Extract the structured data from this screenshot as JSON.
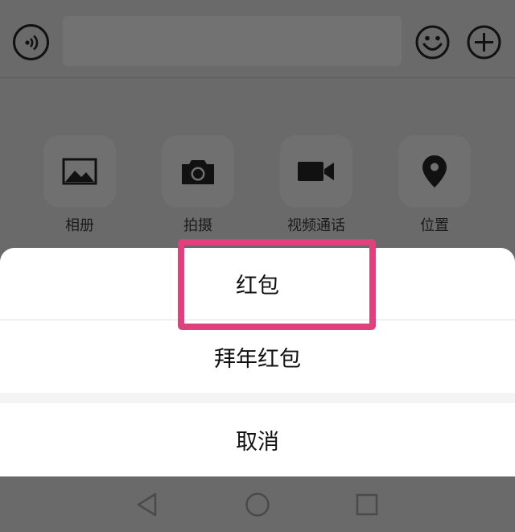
{
  "input_bar": {
    "voice_icon": "voice-icon",
    "emoji_icon": "emoji-icon",
    "plus_icon": "plus-icon"
  },
  "panel": {
    "items": [
      {
        "label": "相册",
        "icon": "image-icon"
      },
      {
        "label": "拍摄",
        "icon": "camera-icon"
      },
      {
        "label": "视频通话",
        "icon": "video-icon"
      },
      {
        "label": "位置",
        "icon": "location-pin-icon"
      }
    ]
  },
  "sheet": {
    "options": [
      {
        "label": "红包"
      },
      {
        "label": "拜年红包"
      }
    ],
    "cancel_label": "取消"
  },
  "colors": {
    "highlight": "#e0417d",
    "overlay": "#6a6a6a"
  },
  "nav": {
    "back_icon": "back-triangle-icon",
    "home_icon": "home-circle-icon",
    "recents_icon": "recents-square-icon"
  }
}
